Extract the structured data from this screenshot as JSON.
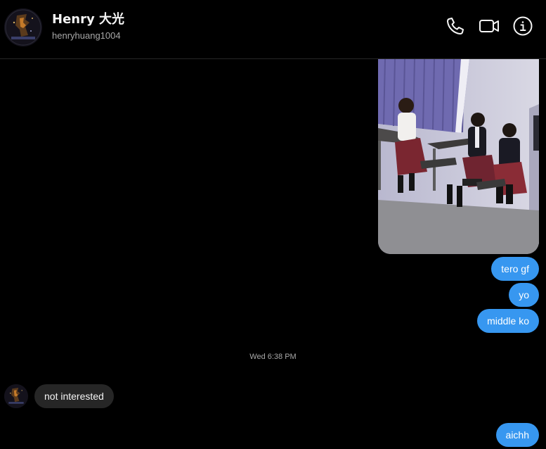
{
  "header": {
    "display_name": "Henry 大光",
    "username": "henryhuang1004",
    "icons": [
      "phone-icon",
      "video-call-icon",
      "info-icon"
    ]
  },
  "thread": {
    "sent_messages_1": [
      "tero gf",
      "yo",
      "middle ko"
    ],
    "timestamp": "Wed 6:38 PM",
    "received_message": "not interested",
    "sent_messages_2": [
      "aichh"
    ]
  },
  "colors": {
    "background": "#000000",
    "outgoing_bubble": "#3797f0",
    "incoming_bubble": "#262626",
    "secondary_text": "#a8a8a8"
  }
}
